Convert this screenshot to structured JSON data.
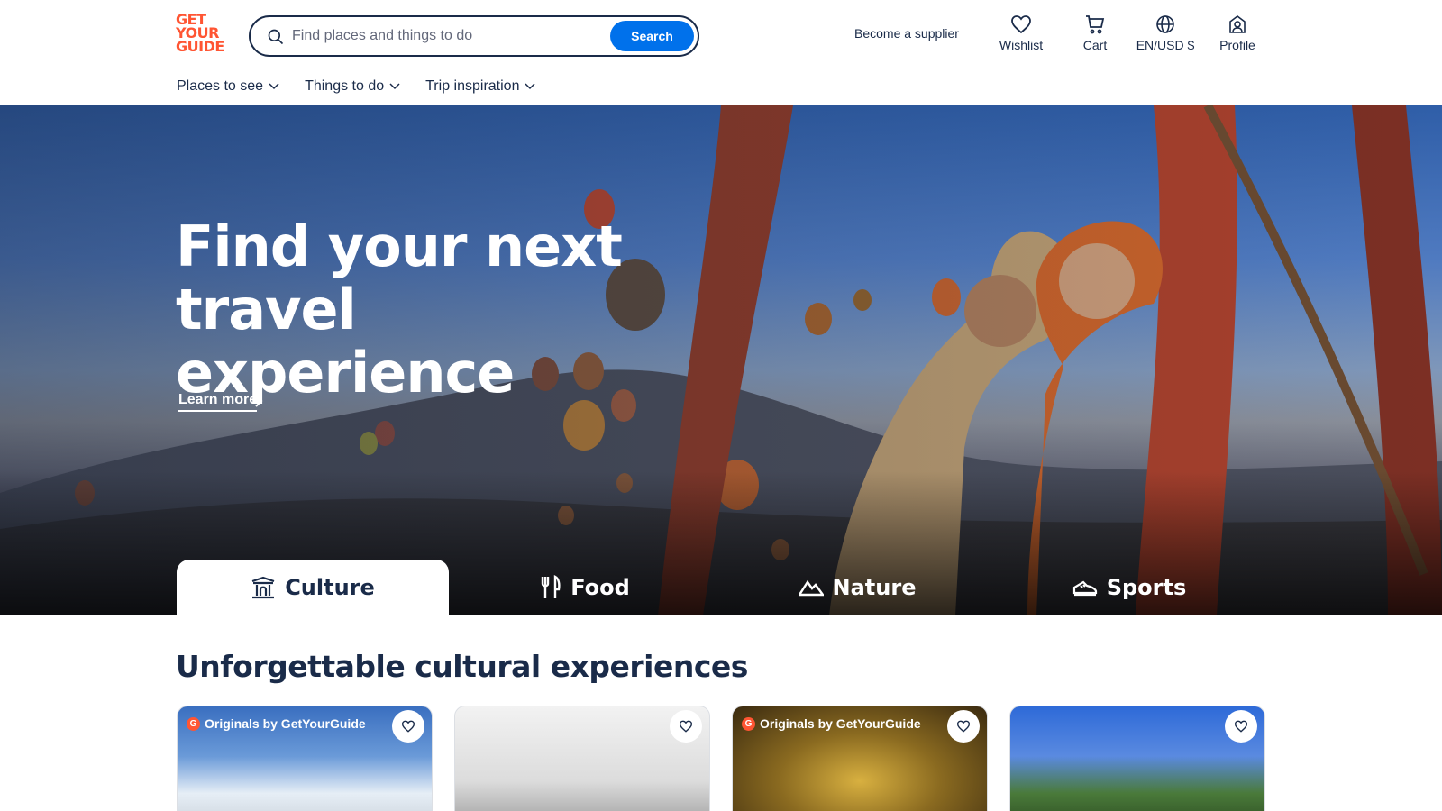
{
  "header": {
    "logo_lines": [
      "GET",
      "YOUR",
      "GUIDE"
    ],
    "search": {
      "placeholder": "Find places and things to do",
      "button_label": "Search"
    },
    "supplier_link": "Become a supplier",
    "actions": [
      {
        "label": "Wishlist",
        "icon": "heart-icon"
      },
      {
        "label": "Cart",
        "icon": "cart-icon"
      },
      {
        "label": "EN/USD $",
        "icon": "globe-icon"
      },
      {
        "label": "Profile",
        "icon": "profile-icon"
      }
    ]
  },
  "nav": [
    {
      "label": "Places to see"
    },
    {
      "label": "Things to do"
    },
    {
      "label": "Trip inspiration"
    }
  ],
  "hero": {
    "title_line1": "Find your next travel",
    "title_line2": "experience",
    "learn_more": "Learn more",
    "tabs": [
      {
        "label": "Culture",
        "icon": "temple-icon",
        "active": true
      },
      {
        "label": "Food",
        "icon": "fork-knife-icon",
        "active": false
      },
      {
        "label": "Nature",
        "icon": "mountain-icon",
        "active": false
      },
      {
        "label": "Sports",
        "icon": "sneaker-icon",
        "active": false
      }
    ]
  },
  "section": {
    "title": "Unforgettable cultural experiences",
    "cards": [
      {
        "badge": "Originals by GetYourGuide",
        "has_badge": true
      },
      {
        "badge": "",
        "has_badge": false
      },
      {
        "badge": "Originals by GetYourGuide",
        "has_badge": true
      },
      {
        "badge": "",
        "has_badge": false
      }
    ]
  },
  "colors": {
    "brand": "#ff5533",
    "primary": "#0071eb",
    "text": "#1a2b49"
  }
}
